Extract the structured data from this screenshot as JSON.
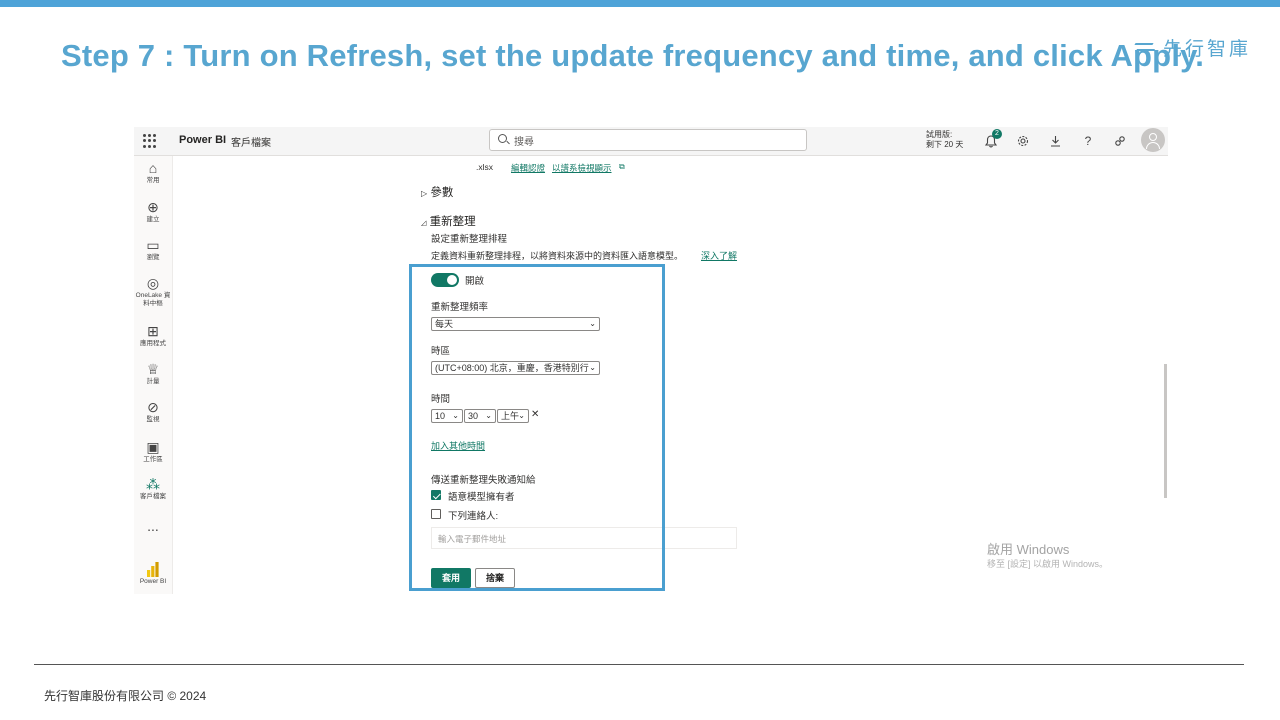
{
  "slide": {
    "title": "Step 7 : Turn on Refresh, set the update frequency and time, and click Apply.",
    "brand": "先行智庫",
    "footer": "先行智庫股份有限公司 © 2024"
  },
  "header": {
    "app_name": "Power BI",
    "workspace": "客戶檔案",
    "search_placeholder": "搜尋",
    "trial_line1": "試用版:",
    "trial_line2": "剩下 20 天",
    "notification_count": "2"
  },
  "nav": {
    "items": [
      {
        "label": "常用",
        "icon": "home-icon"
      },
      {
        "label": "建立",
        "icon": "create-icon"
      },
      {
        "label": "瀏覽",
        "icon": "browse-icon"
      },
      {
        "label": "OneLake 資料中樞",
        "icon": "onelake-icon"
      },
      {
        "label": "應用程式",
        "icon": "apps-icon"
      },
      {
        "label": "計量",
        "icon": "metrics-icon"
      },
      {
        "label": "監視",
        "icon": "monitor-icon"
      },
      {
        "label": "工作區",
        "icon": "workspaces-icon"
      },
      {
        "label": "客戶檔案",
        "icon": "workspace-people-icon"
      },
      {
        "label": "...",
        "icon": "more-icon"
      },
      {
        "label": "Power BI",
        "icon": "powerbi-logo-icon"
      }
    ]
  },
  "settings": {
    "file_ext": ".xlsx",
    "edit_credentials": "編輯認證",
    "show_in_lineage": "以譜系檢視顯示",
    "params_label": "參數",
    "refresh_section": "重新整理",
    "schedule_title": "設定重新整理排程",
    "schedule_desc": "定義資料重新整理排程，以將資料來源中的資料匯入語意模型。",
    "learn_more": "深入了解",
    "toggle_label": "開啟",
    "frequency_label": "重新整理頻率",
    "frequency_value": "每天",
    "timezone_label": "時區",
    "timezone_value": "(UTC+08:00) 北京，重慶，香港特別行",
    "time_label": "時間",
    "hour_value": "10",
    "minute_value": "30",
    "ampm_value": "上午",
    "add_time": "加入其他時間",
    "notify_label": "傳送重新整理失敗通知給",
    "owner_label": "語意模型擁有者",
    "owner_checked": true,
    "contacts_label": "下列連絡人:",
    "contacts_checked": false,
    "email_placeholder": "輸入電子郵件地址",
    "apply_button": "套用",
    "discard_button": "捨棄"
  },
  "watermark": {
    "line1": "啟用 Windows",
    "line2": "移至 [設定] 以啟用 Windows。"
  },
  "colors": {
    "accent": "#117865",
    "title": "#58a6d0",
    "highlight": "#4a9fd0"
  }
}
